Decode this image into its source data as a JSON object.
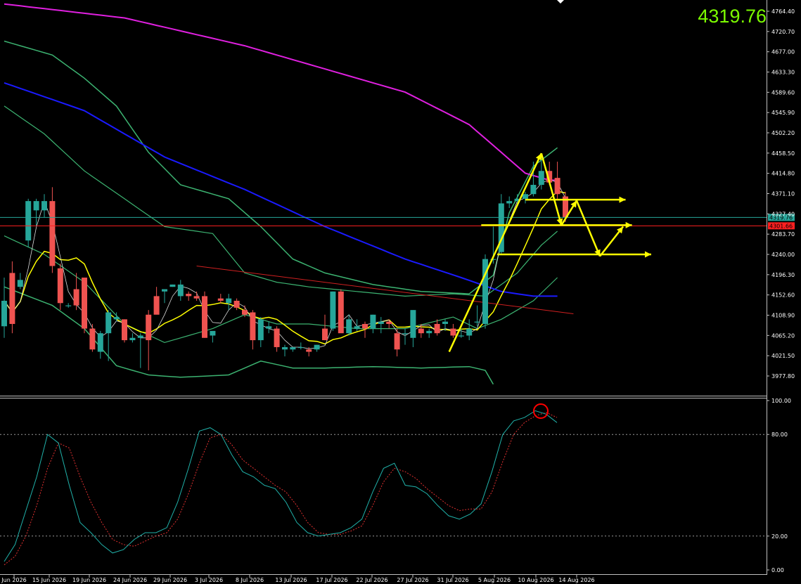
{
  "header": {
    "current_price": "4319.76"
  },
  "colors": {
    "background": "#000000",
    "bull_candle": "#26a69a",
    "bear_candle": "#ef5350",
    "ma_long": "#e020e0",
    "ma_mid": "#1a1aff",
    "bollinger": "#3cb371",
    "ma_fast": "#ffff00",
    "ma_fastest": "#dcdcdc",
    "trendline": "#d02020",
    "annotation": "#ffff00",
    "stoch_main": "#20b2aa",
    "stoch_signal": "#e03030",
    "bid_line": "#ff2020",
    "ask_line": "#26a69a"
  },
  "chart_data": [
    {
      "type": "candlestick",
      "title": "",
      "price_ticks": [
        "4764.40",
        "4720.70",
        "4677.00",
        "4633.30",
        "4589.60",
        "4545.90",
        "4502.20",
        "4458.50",
        "4414.80",
        "4371.10",
        "4327.40",
        "4283.70",
        "4240.00",
        "4196.30",
        "4152.60",
        "4108.90",
        "4065.20",
        "4021.50",
        "3977.80"
      ],
      "date_ticks": [
        "Jun 2026",
        "15 Jun 2026",
        "19 Jun 2026",
        "24 Jun 2026",
        "29 Jun 2026",
        "3 Jul 2026",
        "8 Jul 2026",
        "13 Jul 2026",
        "17 Jul 2026",
        "22 Jul 2026",
        "27 Jul 2026",
        "31 Jul 2026",
        "5 Aug 2026",
        "10 Aug 2026",
        "14 Aug 2026"
      ],
      "ylim": [
        3960,
        4790
      ],
      "price_label": "4319.76",
      "bid_label": "4301.66",
      "candles": [
        {
          "o": 4085,
          "h": 4190,
          "l": 4060,
          "c": 4140
        },
        {
          "o": 4200,
          "h": 4225,
          "l": 4070,
          "c": 4090
        },
        {
          "o": 4170,
          "h": 4200,
          "l": 4165,
          "c": 4185
        },
        {
          "o": 4270,
          "h": 4360,
          "l": 4255,
          "c": 4355
        },
        {
          "o": 4335,
          "h": 4360,
          "l": 4300,
          "c": 4355
        },
        {
          "o": 4335,
          "h": 4370,
          "l": 4320,
          "c": 4355
        },
        {
          "o": 4355,
          "h": 4385,
          "l": 4200,
          "c": 4215
        },
        {
          "o": 4210,
          "h": 4220,
          "l": 4120,
          "c": 4135
        },
        {
          "o": 4130,
          "h": 4135,
          "l": 4125,
          "c": 4130
        },
        {
          "o": 4165,
          "h": 4200,
          "l": 4120,
          "c": 4130
        },
        {
          "o": 4190,
          "h": 4190,
          "l": 4070,
          "c": 4080
        },
        {
          "o": 4080,
          "h": 4090,
          "l": 4030,
          "c": 4035
        },
        {
          "o": 4030,
          "h": 4075,
          "l": 4015,
          "c": 4070
        },
        {
          "o": 4070,
          "h": 4120,
          "l": 4010,
          "c": 4115
        },
        {
          "o": 4100,
          "h": 4115,
          "l": 4095,
          "c": 4105
        },
        {
          "o": 4100,
          "h": 4100,
          "l": 4050,
          "c": 4055
        },
        {
          "o": 4055,
          "h": 4070,
          "l": 4050,
          "c": 4060
        },
        {
          "o": 4060,
          "h": 4070,
          "l": 3995,
          "c": 4065
        },
        {
          "o": 4110,
          "h": 4120,
          "l": 3990,
          "c": 4055
        },
        {
          "o": 4150,
          "h": 4170,
          "l": 4145,
          "c": 4110
        },
        {
          "o": 4160,
          "h": 4165,
          "l": 4135,
          "c": 4165
        },
        {
          "o": 4170,
          "h": 4175,
          "l": 4170,
          "c": 4175
        },
        {
          "o": 4150,
          "h": 4185,
          "l": 4140,
          "c": 4175
        },
        {
          "o": 4155,
          "h": 4160,
          "l": 4140,
          "c": 4150
        },
        {
          "o": 4150,
          "h": 4160,
          "l": 4140,
          "c": 4145
        },
        {
          "o": 4150,
          "h": 4160,
          "l": 4060,
          "c": 4060
        },
        {
          "o": 4065,
          "h": 4070,
          "l": 4050,
          "c": 4075
        },
        {
          "o": 4145,
          "h": 4155,
          "l": 4135,
          "c": 4140
        },
        {
          "o": 4135,
          "h": 4155,
          "l": 4120,
          "c": 4145
        },
        {
          "o": 4140,
          "h": 4145,
          "l": 4120,
          "c": 4125
        },
        {
          "o": 4120,
          "h": 4130,
          "l": 4105,
          "c": 4110
        },
        {
          "o": 4115,
          "h": 4120,
          "l": 4035,
          "c": 4055
        },
        {
          "o": 4055,
          "h": 4105,
          "l": 4040,
          "c": 4100
        },
        {
          "o": 4080,
          "h": 4095,
          "l": 4070,
          "c": 4085
        },
        {
          "o": 4080,
          "h": 4085,
          "l": 4030,
          "c": 4040
        },
        {
          "o": 4035,
          "h": 4045,
          "l": 4020,
          "c": 4040
        },
        {
          "o": 4035,
          "h": 4040,
          "l": 4030,
          "c": 4040
        },
        {
          "o": 4040,
          "h": 4050,
          "l": 4035,
          "c": 4040
        },
        {
          "o": 4035,
          "h": 4040,
          "l": 4020,
          "c": 4030
        },
        {
          "o": 4035,
          "h": 4045,
          "l": 4030,
          "c": 4045
        },
        {
          "o": 4080,
          "h": 4110,
          "l": 4055,
          "c": 4055
        },
        {
          "o": 4080,
          "h": 4160,
          "l": 4075,
          "c": 4160
        },
        {
          "o": 4160,
          "h": 4165,
          "l": 4080,
          "c": 4070
        },
        {
          "o": 4070,
          "h": 4110,
          "l": 4065,
          "c": 4100
        },
        {
          "o": 4080,
          "h": 4100,
          "l": 4075,
          "c": 4085
        },
        {
          "o": 4090,
          "h": 4095,
          "l": 4060,
          "c": 4080
        },
        {
          "o": 4080,
          "h": 4110,
          "l": 4070,
          "c": 4110
        },
        {
          "o": 4090,
          "h": 4105,
          "l": 4070,
          "c": 4095
        },
        {
          "o": 4095,
          "h": 4100,
          "l": 4080,
          "c": 4090
        },
        {
          "o": 4070,
          "h": 4080,
          "l": 4020,
          "c": 4035
        },
        {
          "o": 4070,
          "h": 4080,
          "l": 4045,
          "c": 4070
        },
        {
          "o": 4060,
          "h": 4120,
          "l": 4040,
          "c": 4120
        },
        {
          "o": 4080,
          "h": 4090,
          "l": 4060,
          "c": 4070
        },
        {
          "o": 4070,
          "h": 4080,
          "l": 4060,
          "c": 4075
        },
        {
          "o": 4090,
          "h": 4100,
          "l": 4065,
          "c": 4070
        },
        {
          "o": 4090,
          "h": 4100,
          "l": 4075,
          "c": 4095
        },
        {
          "o": 4080,
          "h": 4090,
          "l": 4060,
          "c": 4065
        },
        {
          "o": 4065,
          "h": 4080,
          "l": 4060,
          "c": 4065
        },
        {
          "o": 4065,
          "h": 4100,
          "l": 4055,
          "c": 4080
        },
        {
          "o": 4095,
          "h": 4130,
          "l": 4085,
          "c": 4095
        },
        {
          "o": 4090,
          "h": 4240,
          "l": 4080,
          "c": 4230
        },
        {
          "o": 4230,
          "h": 4300,
          "l": 4220,
          "c": 4230
        },
        {
          "o": 4245,
          "h": 4370,
          "l": 4240,
          "c": 4350
        },
        {
          "o": 4350,
          "h": 4365,
          "l": 4340,
          "c": 4355
        },
        {
          "o": 4355,
          "h": 4370,
          "l": 4345,
          "c": 4360
        },
        {
          "o": 4360,
          "h": 4375,
          "l": 4350,
          "c": 4370
        },
        {
          "o": 4370,
          "h": 4440,
          "l": 4365,
          "c": 4390
        },
        {
          "o": 4390,
          "h": 4450,
          "l": 4380,
          "c": 4420
        },
        {
          "o": 4420,
          "h": 4440,
          "l": 4390,
          "c": 4395
        },
        {
          "o": 4405,
          "h": 4440,
          "l": 4360,
          "c": 4370
        },
        {
          "o": 4365,
          "h": 4375,
          "l": 4310,
          "c": 4320
        }
      ],
      "stochastic": {
        "ylim": [
          0,
          100
        ],
        "levels_drawn": [
          80,
          20
        ],
        "scale_labels": [
          "100.00",
          "80.00",
          "20.00",
          "0.00"
        ],
        "main": [
          5,
          15,
          35,
          55,
          80,
          75,
          50,
          28,
          22,
          15,
          10,
          12,
          18,
          22,
          22,
          25,
          40,
          60,
          82,
          84,
          80,
          68,
          58,
          55,
          50,
          48,
          40,
          28,
          22,
          20,
          21,
          22,
          25,
          30,
          46,
          60,
          63,
          50,
          49,
          45,
          38,
          32,
          30,
          33,
          39,
          58,
          80,
          88,
          90,
          94,
          92,
          87
        ],
        "signal": [
          3,
          8,
          20,
          38,
          60,
          75,
          72,
          55,
          40,
          28,
          18,
          15,
          14,
          17,
          20,
          22,
          30,
          45,
          63,
          78,
          80,
          74,
          65,
          60,
          55,
          50,
          46,
          38,
          28,
          22,
          21,
          21,
          23,
          26,
          38,
          52,
          60,
          58,
          54,
          48,
          43,
          38,
          35,
          36,
          36,
          46,
          64,
          80,
          87,
          91,
          93,
          90
        ]
      }
    }
  ]
}
